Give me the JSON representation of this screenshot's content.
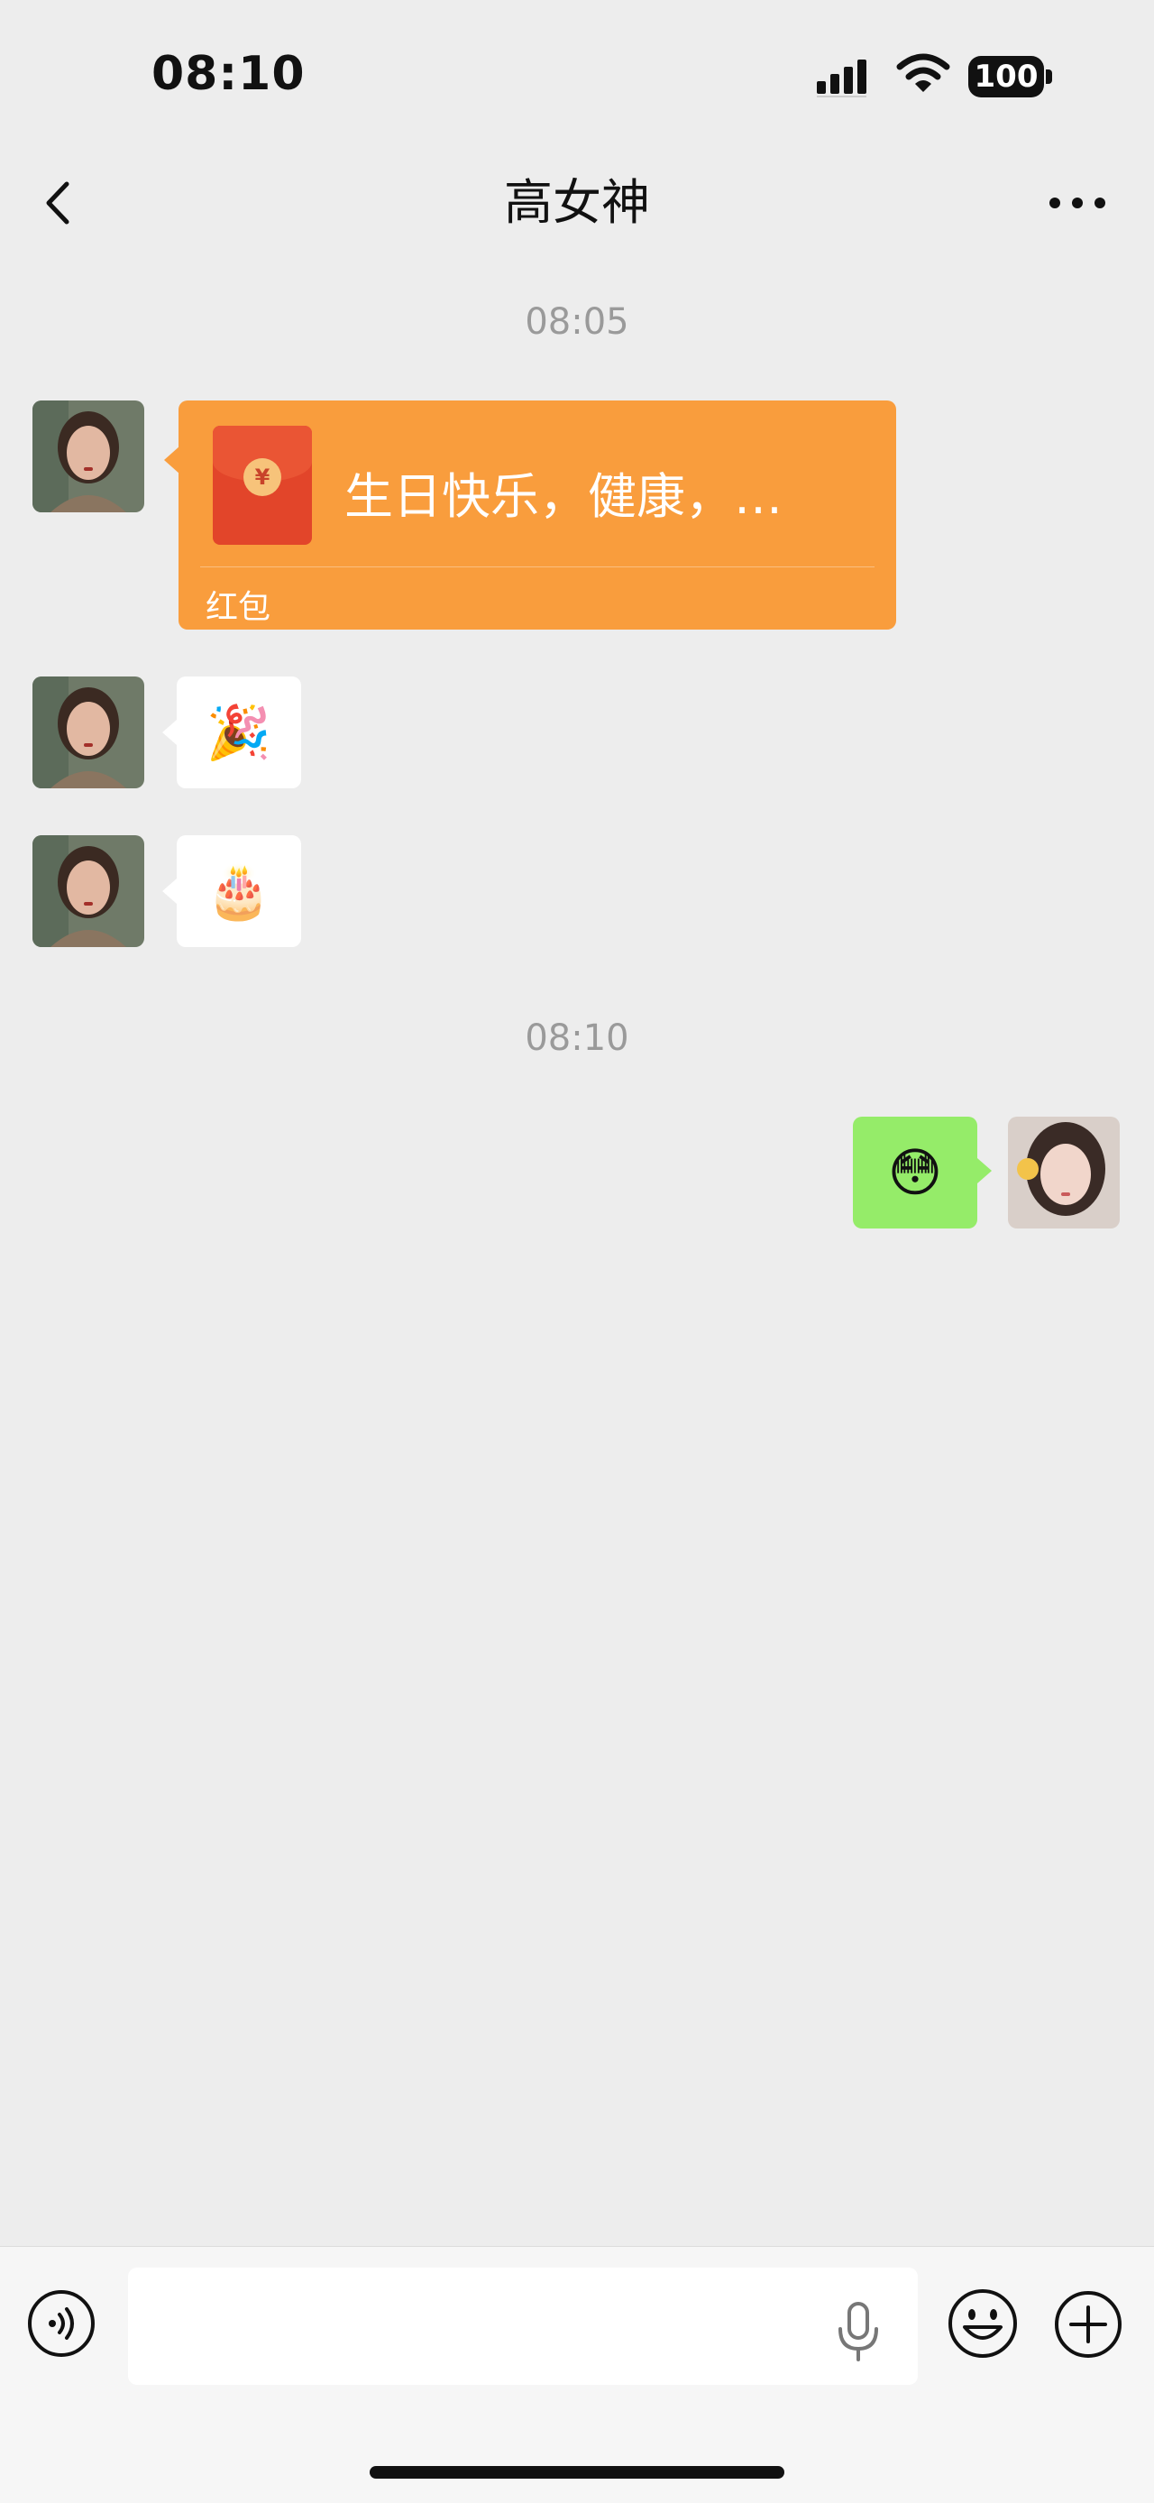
{
  "status_bar": {
    "time": "08:10",
    "battery": "100"
  },
  "header": {
    "title": "高女神"
  },
  "messages": {
    "timestamp1": "08:05",
    "red_packet": {
      "text": "生日快乐，健康，…",
      "label": "红包",
      "coin_symbol": "¥"
    },
    "emoji_party": "🎉",
    "emoji_cake": "🎂",
    "timestamp2": "08:10",
    "emoji_sent": "😳"
  },
  "colors": {
    "background": "#ededed",
    "red_packet": "#f99d3d",
    "sent_bubble": "#95ec69",
    "received_bubble": "#ffffff"
  },
  "icons": [
    "back-icon",
    "more-icon",
    "voice-icon",
    "mic-icon",
    "emoji-icon",
    "plus-icon"
  ]
}
